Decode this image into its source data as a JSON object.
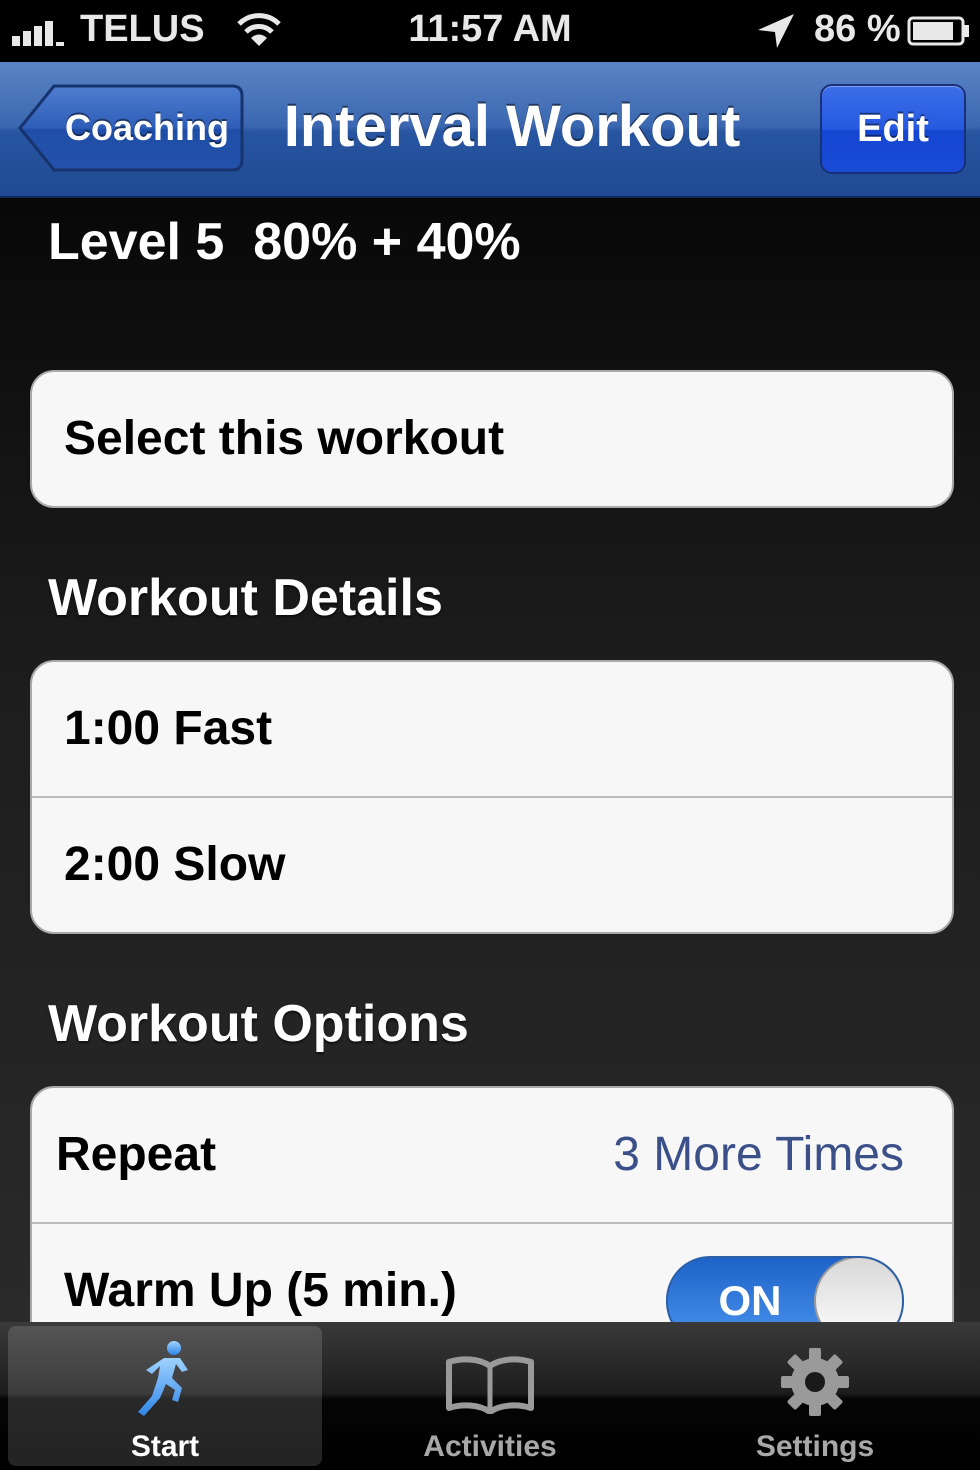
{
  "status_bar": {
    "carrier": "TELUS",
    "time": "11:57 AM",
    "battery_percent": "86 %"
  },
  "nav": {
    "back_label": "Coaching",
    "title": "Interval Workout",
    "edit_label": "Edit"
  },
  "workout": {
    "level_text": "Level 5  80% + 40%",
    "select_label": "Select this workout"
  },
  "details": {
    "header": "Workout Details",
    "items": [
      "1:00 Fast",
      "2:00 Slow"
    ]
  },
  "options": {
    "header": "Workout Options",
    "repeat_label": "Repeat",
    "repeat_value": "3 More Times",
    "warmup_label": "Warm Up (5 min.)",
    "warmup_toggle": "ON"
  },
  "tabs": [
    {
      "label": "Start",
      "icon": "runner-icon",
      "selected": true
    },
    {
      "label": "Activities",
      "icon": "book-icon",
      "selected": false
    },
    {
      "label": "Settings",
      "icon": "gear-icon",
      "selected": false
    }
  ],
  "colors": {
    "nav_blue": "#2f5ea8",
    "edit_blue": "#2156dc",
    "value_blue": "#3b5088",
    "toggle_blue": "#3580e0"
  }
}
